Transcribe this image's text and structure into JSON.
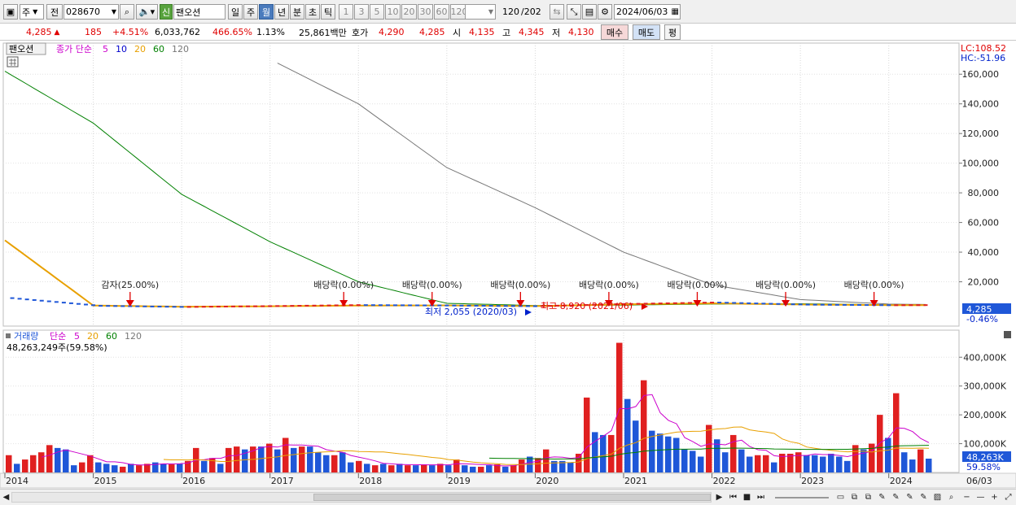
{
  "toolbar": {
    "market_label": "주",
    "market_sub": "전",
    "code": "028670",
    "credit_badge": "신",
    "name": "팬오션",
    "periods": [
      "일",
      "주",
      "월",
      "년",
      "분",
      "초",
      "틱"
    ],
    "active_period": "월",
    "intervals": [
      "1",
      "3",
      "5",
      "10",
      "20",
      "30",
      "60",
      "120"
    ],
    "count": "120",
    "count_total": "/202",
    "date": "2024/06/03"
  },
  "quote": {
    "price": "4,285",
    "change": "185",
    "change_pct": "+4.51%",
    "volume": "6,033,762",
    "vol_ratio": "466.65%",
    "turnover": "1.13%",
    "amount": "25,861백만",
    "bid_label": "호가",
    "bid1": "4,290",
    "bid2": "4,285",
    "open_label": "시",
    "open": "4,135",
    "high_label": "고",
    "high": "4,345",
    "low_label": "저",
    "low": "4,130",
    "buy_btn": "매수",
    "sell_btn": "매도",
    "eval_btn": "평"
  },
  "price_panel": {
    "title": "팬오션",
    "legend_label": "종가 단순",
    "ma_periods": [
      "5",
      "10",
      "20",
      "60",
      "120"
    ],
    "ma_colors": [
      "#cc00cc",
      "#0000cc",
      "#e8a000",
      "#008000",
      "#777777"
    ],
    "lc": "LC:108.52",
    "hc": "HC:-51.96",
    "last_price": "4,285",
    "last_change": "-0.46%",
    "min_label": "최저 2,055 (2020/03)",
    "max_label": "최고 8,920 (2021/06)"
  },
  "volume_panel": {
    "legend_label": "거래량",
    "legend_sub": "단순",
    "ma_periods": [
      "5",
      "20",
      "60",
      "120"
    ],
    "ma_colors": [
      "#cc00cc",
      "#e8a000",
      "#008000",
      "#777777"
    ],
    "summary": "48,263,249주(59.58%)",
    "last_volume": "48,263K",
    "last_pct": "59.58%"
  },
  "x_labels": [
    "2014",
    "2015",
    "2016",
    "2017",
    "2018",
    "2019",
    "2020",
    "2021",
    "2022",
    "2023",
    "2024"
  ],
  "x_last_label": "06/03",
  "chart_data": [
    {
      "type": "line",
      "title": "팬오션",
      "y_ticks": [
        20000,
        40000,
        60000,
        80000,
        100000,
        120000,
        140000,
        160000
      ],
      "ylim": [
        0,
        170000
      ],
      "x": [
        "2014-01",
        "2015-01",
        "2016-01",
        "2017-01",
        "2018-01",
        "2019-01",
        "2020-01",
        "2021-01",
        "2022-01",
        "2023-01",
        "2024-01",
        "2024-06"
      ],
      "series": [
        {
          "name": "종가",
          "values": [
            9000,
            3800,
            3000,
            3600,
            4300,
            4000,
            3500,
            5000,
            6000,
            4600,
            4200,
            4285
          ]
        },
        {
          "name": "60",
          "values": [
            162000,
            127000,
            79000,
            47000,
            20000,
            5500,
            4000,
            4300,
            5000,
            5200,
            4500,
            4400
          ]
        },
        {
          "name": "120",
          "values": [
            null,
            null,
            null,
            170000,
            140000,
            97000,
            70000,
            40000,
            18000,
            8000,
            5000,
            4700
          ]
        },
        {
          "name": "20",
          "values": [
            48000,
            4000,
            3200,
            3500,
            4000,
            4100,
            3600,
            4800,
            5500,
            4700,
            4300,
            4300
          ]
        }
      ],
      "annotations": [
        "감자(25.00%)",
        "배당락(0.00%)",
        "배당락(0.00%)",
        "배당락(0.00%)",
        "배당락(0.00%)",
        "배당락(0.00%)",
        "배당락(0.00%)",
        "배당락(0.00%)"
      ],
      "annotation_dates": [
        "2015-06",
        "2017-11",
        "2018-11",
        "2019-11",
        "2020-11",
        "2021-11",
        "2022-11",
        "2023-11"
      ]
    },
    {
      "type": "bar",
      "title": "거래량",
      "y_ticks": [
        100000,
        200000,
        300000,
        400000
      ],
      "y_tick_suffix": "K",
      "ylim": [
        0,
        460000
      ],
      "values": [
        60000,
        30000,
        45000,
        60000,
        70000,
        95000,
        85000,
        80000,
        25000,
        35000,
        60000,
        35000,
        30000,
        25000,
        20000,
        30000,
        25000,
        30000,
        35000,
        30000,
        28000,
        30000,
        40000,
        85000,
        40000,
        50000,
        30000,
        85000,
        90000,
        80000,
        90000,
        90000,
        100000,
        80000,
        120000,
        85000,
        90000,
        90000,
        70000,
        60000,
        60000,
        70000,
        35000,
        40000,
        30000,
        25000,
        30000,
        25000,
        30000,
        25000,
        25000,
        28000,
        25000,
        30000,
        25000,
        45000,
        25000,
        20000,
        20000,
        25000,
        28000,
        20000,
        25000,
        45000,
        55000,
        50000,
        80000,
        40000,
        40000,
        35000,
        65000,
        260000,
        140000,
        130000,
        130000,
        450000,
        255000,
        180000,
        320000,
        145000,
        135000,
        125000,
        120000,
        80000,
        75000,
        55000,
        165000,
        115000,
        70000,
        130000,
        80000,
        55000,
        60000,
        60000,
        35000,
        65000,
        65000,
        70000,
        60000,
        60000,
        55000,
        65000,
        55000,
        40000,
        95000,
        80000,
        100000,
        200000,
        120000,
        275000,
        70000,
        45000,
        80000,
        48000
      ],
      "up": [
        true,
        false,
        true,
        true,
        true,
        true,
        false,
        false,
        false,
        true,
        true,
        false,
        false,
        false,
        true,
        false,
        true,
        true,
        false,
        false,
        true,
        false,
        true,
        true,
        false,
        true,
        false,
        true,
        true,
        false,
        true,
        false,
        true,
        false,
        true,
        false,
        true,
        false,
        false,
        false,
        true,
        false,
        false,
        true,
        false,
        true,
        false,
        true,
        false,
        true,
        false,
        true,
        false,
        true,
        false,
        true,
        false,
        false,
        true,
        false,
        true,
        false,
        true,
        true,
        false,
        true,
        true,
        false,
        false,
        false,
        true,
        true,
        false,
        false,
        true,
        true,
        false,
        false,
        true,
        false,
        false,
        false,
        false,
        false,
        false,
        false,
        true,
        false,
        false,
        true,
        false,
        false,
        true,
        true,
        false,
        true,
        true,
        true,
        false,
        false,
        false,
        false,
        false,
        false,
        true,
        false,
        true,
        true,
        false,
        true,
        false,
        false,
        true,
        false
      ]
    }
  ]
}
